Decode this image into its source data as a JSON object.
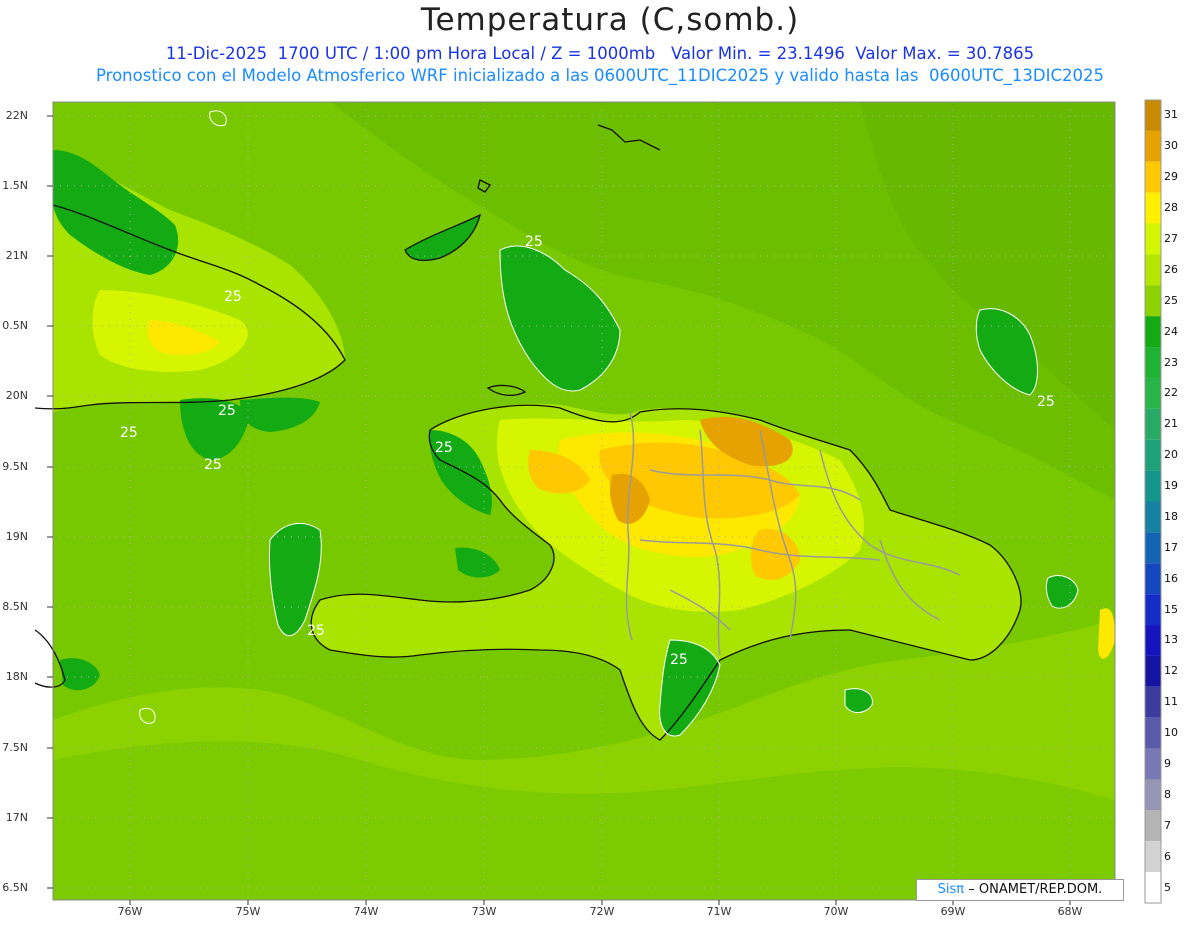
{
  "header": {
    "title": "Temperatura (C,somb.)",
    "subtitle1": "11-Dic-2025  1700 UTC / 1:00 pm Hora Local / Z = 1000mb   Valor Min. = 23.1496  Valor Max. = 30.7865",
    "subtitle2": "Pronostico con el Modelo Atmosferico WRF inicializado a las 0600UTC_11DIC2025 y valido hasta las  0600UTC_13DIC2025"
  },
  "axes": {
    "lat_labels": [
      "22N",
      "1.5N",
      "21N",
      "0.5N",
      "20N",
      "9.5N",
      "19N",
      "8.5N",
      "18N",
      "7.5N",
      "17N",
      "6.5N"
    ],
    "lon_labels": [
      "76W",
      "75W",
      "74W",
      "73W",
      "72W",
      "71W",
      "70W",
      "69W",
      "68W"
    ]
  },
  "contour_labels": [
    "25",
    "25",
    "25",
    "25",
    "25",
    "25",
    "25",
    "25",
    "25"
  ],
  "colorbar": {
    "labels": [
      "31",
      "30",
      "29",
      "28",
      "27",
      "26",
      "25",
      "24",
      "23",
      "22",
      "21",
      "20",
      "19",
      "18",
      "17",
      "16",
      "15",
      "13",
      "12",
      "11",
      "10",
      "9",
      "8",
      "7",
      "6",
      "5"
    ],
    "colors": [
      "#c78a00",
      "#e6a200",
      "#ffc800",
      "#fff000",
      "#d2f500",
      "#b4e600",
      "#8cd200",
      "#14aa14",
      "#1eb432",
      "#28b446",
      "#28aa64",
      "#1ea078",
      "#14968c",
      "#1482a0",
      "#1464b4",
      "#1446be",
      "#142dc8",
      "#1414be",
      "#1414a0",
      "#3c3ca0",
      "#5a5aaa",
      "#7878b4",
      "#9696b4",
      "#b4b4b4",
      "#d2d2d2",
      "#ffffff"
    ]
  },
  "credit": {
    "brand": "Sisπ",
    "text": "– ONAMET/REP.DOM."
  }
}
